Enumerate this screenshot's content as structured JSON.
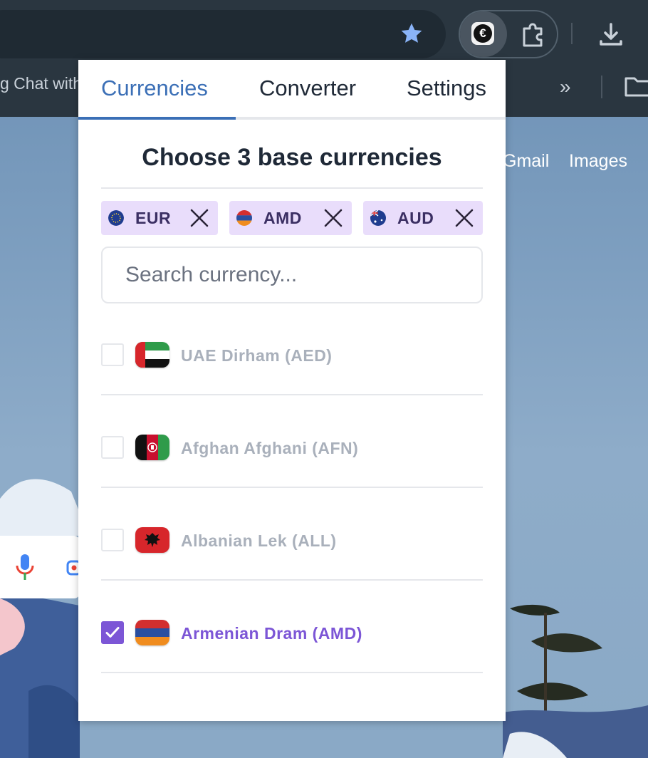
{
  "browser": {
    "bookmarks_partial_text": "g Chat with",
    "bookmarks_more_glyph": "»",
    "icons": [
      "star-icon",
      "currency-extension-icon",
      "puzzle-icon",
      "download-icon",
      "folder-icon"
    ]
  },
  "page": {
    "links": [
      "Gmail",
      "Images"
    ],
    "icons": [
      "microphone-icon",
      "camera-lens-icon"
    ]
  },
  "popup": {
    "tabs": [
      {
        "label": "Currencies",
        "active": true
      },
      {
        "label": "Converter",
        "active": false
      },
      {
        "label": "Settings",
        "active": false
      }
    ],
    "heading": "Choose 3 base currencies",
    "selected_chips": [
      {
        "code": "EUR",
        "flag": "eu"
      },
      {
        "code": "AMD",
        "flag": "am"
      },
      {
        "code": "AUD",
        "flag": "au"
      }
    ],
    "search": {
      "placeholder": "Search currency...",
      "value": ""
    },
    "currencies": [
      {
        "label": "UAE Dirham (AED)",
        "checked": false,
        "flag": "ae"
      },
      {
        "label": "Afghan Afghani (AFN)",
        "checked": false,
        "flag": "af"
      },
      {
        "label": "Albanian Lek (ALL)",
        "checked": false,
        "flag": "al"
      },
      {
        "label": "Armenian Dram (AMD)",
        "checked": true,
        "flag": "am"
      }
    ],
    "colors": {
      "accent": "#3b6fb6",
      "checked": "#7c56d6",
      "chip_bg": "#e9ddfb"
    }
  }
}
